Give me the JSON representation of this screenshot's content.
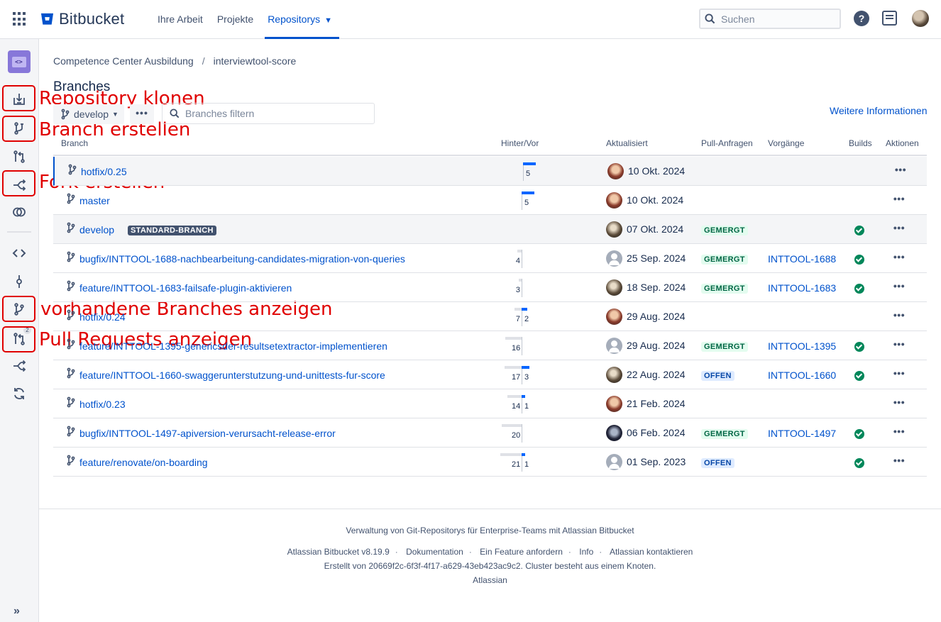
{
  "header": {
    "logo_text": "Bitbucket",
    "nav": [
      {
        "label": "Ihre Arbeit"
      },
      {
        "label": "Projekte"
      },
      {
        "label": "Repositorys"
      }
    ],
    "search_placeholder": "Suchen",
    "help_label": "?"
  },
  "sidebar": {
    "pr_count": "2",
    "annotations": {
      "clone": "Repository klonen",
      "create_branch": "Branch erstellen",
      "fork": "Fork erstellen",
      "branches": "vorhandene Branches anzeigen",
      "pull_requests": "Pull Requests anzeigen"
    },
    "collapse_label": "»"
  },
  "breadcrumb": {
    "project": "Competence Center Ausbildung",
    "separator": "/",
    "repo": "interviewtool-score"
  },
  "page": {
    "title": "Branches",
    "branch_selector": "develop",
    "more_label": "•••",
    "filter_placeholder": "Branches filtern",
    "more_info": "Weitere Informationen"
  },
  "table": {
    "headers": {
      "branch": "Branch",
      "behind_ahead": "Hinter/Vor",
      "updated": "Aktualisiert",
      "pull_requests": "Pull-Anfragen",
      "issues": "Vorgänge",
      "builds": "Builds",
      "actions": "Aktionen"
    },
    "rows": [
      {
        "name": "hotfix/0.25",
        "badge": "",
        "behind": "",
        "ahead": "5",
        "behind_frac": 0,
        "ahead_frac": 0.21,
        "avatar": "a",
        "date": "10 Okt. 2024",
        "pr": "",
        "issue": "",
        "build": false,
        "actions": "•••"
      },
      {
        "name": "master",
        "badge": "",
        "behind": "",
        "ahead": "5",
        "behind_frac": 0,
        "ahead_frac": 0.21,
        "avatar": "a",
        "date": "10 Okt. 2024",
        "pr": "",
        "issue": "",
        "build": false,
        "actions": "•••"
      },
      {
        "name": "develop",
        "badge": "STANDARD-BRANCH",
        "behind": "",
        "ahead": "",
        "behind_frac": 0,
        "ahead_frac": 0,
        "avatar": "b",
        "date": "07 Okt. 2024",
        "pr": "GEMERGT",
        "issue": "",
        "build": true,
        "actions": "•••"
      },
      {
        "name": "bugfix/INTTOOL-1688-nachbearbeitung-candidates-migration-von-queries",
        "badge": "",
        "behind": "4",
        "ahead": "",
        "behind_frac": 0.17,
        "ahead_frac": 0,
        "avatar": "default",
        "date": "25 Sep. 2024",
        "pr": "GEMERGT",
        "issue": "INTTOOL-1688",
        "build": true,
        "actions": "•••"
      },
      {
        "name": "feature/INTTOOL-1683-failsafe-plugin-aktivieren",
        "badge": "",
        "behind": "3",
        "ahead": "",
        "behind_frac": 0.13,
        "ahead_frac": 0,
        "avatar": "b",
        "date": "18 Sep. 2024",
        "pr": "GEMERGT",
        "issue": "INTTOOL-1683",
        "build": true,
        "actions": "•••"
      },
      {
        "name": "hotfix/0.24",
        "badge": "",
        "behind": "7",
        "ahead": "2",
        "behind_frac": 0.29,
        "ahead_frac": 0.09,
        "avatar": "a",
        "date": "29 Aug. 2024",
        "pr": "",
        "issue": "",
        "build": false,
        "actions": "•••"
      },
      {
        "name": "feature/INTTOOL-1395-genericsder-resultsetextractor-implementieren",
        "badge": "",
        "behind": "16",
        "ahead": "",
        "behind_frac": 0.67,
        "ahead_frac": 0,
        "avatar": "default",
        "date": "29 Aug. 2024",
        "pr": "GEMERGT",
        "issue": "INTTOOL-1395",
        "build": true,
        "actions": "•••"
      },
      {
        "name": "feature/INTTOOL-1660-swaggerunterstutzung-und-unittests-fur-score",
        "badge": "",
        "behind": "17",
        "ahead": "3",
        "behind_frac": 0.71,
        "ahead_frac": 0.13,
        "avatar": "b",
        "date": "22 Aug. 2024",
        "pr": "OFFEN",
        "issue": "INTTOOL-1660",
        "build": true,
        "actions": "•••"
      },
      {
        "name": "hotfix/0.23",
        "badge": "",
        "behind": "14",
        "ahead": "1",
        "behind_frac": 0.58,
        "ahead_frac": 0.05,
        "avatar": "a",
        "date": "21 Feb. 2024",
        "pr": "",
        "issue": "",
        "build": false,
        "actions": "•••"
      },
      {
        "name": "bugfix/INTTOOL-1497-apiversion-verursacht-release-error",
        "badge": "",
        "behind": "20",
        "ahead": "",
        "behind_frac": 0.83,
        "ahead_frac": 0,
        "avatar": "c",
        "date": "06 Feb. 2024",
        "pr": "GEMERGT",
        "issue": "INTTOOL-1497",
        "build": true,
        "actions": "•••"
      },
      {
        "name": "feature/renovate/on-boarding",
        "badge": "",
        "behind": "21",
        "ahead": "1",
        "behind_frac": 0.88,
        "ahead_frac": 0.05,
        "avatar": "default",
        "date": "01 Sep. 2023",
        "pr": "OFFEN",
        "issue": "",
        "build": true,
        "actions": "•••"
      }
    ]
  },
  "footer": {
    "tagline": "Verwaltung von Git-Repositorys für Enterprise-Teams mit Atlassian Bitbucket",
    "links": [
      "Atlassian Bitbucket v8.19.9",
      "Dokumentation",
      "Ein Feature anfordern",
      "Info",
      "Atlassian kontaktieren"
    ],
    "build_info": "Erstellt von 20669f2c-6f3f-4f17-a629-43eb423ac9c2. Cluster besteht aus einem Knoten.",
    "brand": "Atlassian"
  },
  "colors": {
    "accent": "#0052cc",
    "annotation": "#e00000",
    "merged": "#006644",
    "open": "#0747a6",
    "build_success": "#00875a"
  }
}
